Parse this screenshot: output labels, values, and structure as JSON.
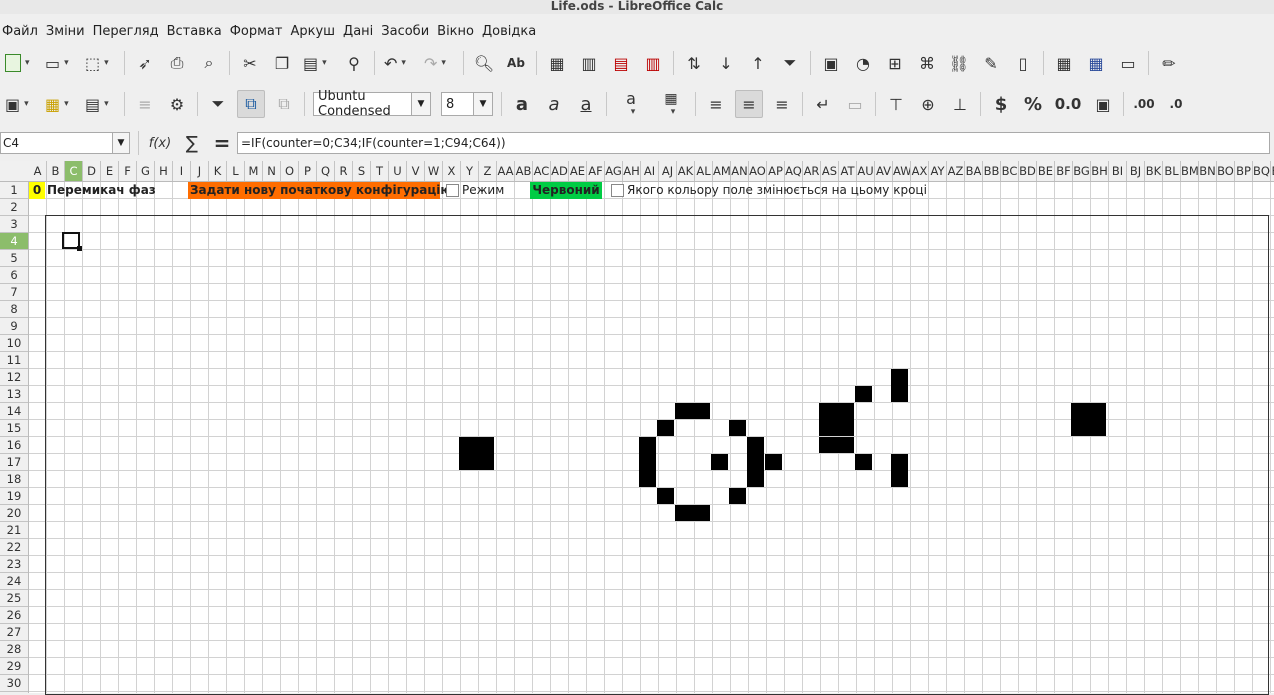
{
  "window": {
    "title": "Life.ods - LibreOffice Calc"
  },
  "menu": [
    "Файл",
    "Зміни",
    "Перегляд",
    "Вставка",
    "Формат",
    "Аркуш",
    "Дані",
    "Засоби",
    "Вікно",
    "Довідка"
  ],
  "toolbar": {
    "font_name": "Ubuntu Condensed",
    "font_size": "8",
    "bold_label": "a",
    "italic_label": "a",
    "underline_label": "a",
    "currency_label": "$",
    "percent_label": "%",
    "number_label": "0.0",
    "font_color": "#8b0000",
    "highlight_color": "#ffee00"
  },
  "formula_bar": {
    "name_box": "C4",
    "fx_label": "f(x)",
    "sum_label": "∑",
    "equals_label": "=",
    "formula": "=IF(counter=0;C34;IF(counter=1;C94;C64))"
  },
  "columns": [
    "A",
    "B",
    "C",
    "D",
    "E",
    "F",
    "G",
    "H",
    "I",
    "J",
    "K",
    "L",
    "M",
    "N",
    "O",
    "P",
    "Q",
    "R",
    "S",
    "T",
    "U",
    "V",
    "W",
    "X",
    "Y",
    "Z",
    "AA",
    "AB",
    "AC",
    "AD",
    "AE",
    "AF",
    "AG",
    "AH",
    "AI",
    "AJ",
    "AK",
    "AL",
    "AM",
    "AN",
    "AO",
    "AP",
    "AQ",
    "AR",
    "AS",
    "AT",
    "AU",
    "AV",
    "AW",
    "AX",
    "AY",
    "AZ",
    "BA",
    "BB",
    "BC",
    "BD",
    "BE",
    "BF",
    "BG",
    "BH",
    "BI",
    "BJ",
    "BK",
    "BL",
    "BM",
    "BN",
    "BO",
    "BP",
    "BQ",
    "BR"
  ],
  "selected_column": "C",
  "rows": [
    "1",
    "2",
    "3",
    "4",
    "5",
    "6",
    "7",
    "8",
    "9",
    "10",
    "11",
    "12",
    "13",
    "14",
    "15",
    "16",
    "17",
    "18",
    "19",
    "20",
    "21",
    "22",
    "23",
    "24",
    "25",
    "26",
    "27",
    "28",
    "29",
    "30"
  ],
  "selected_row": "4",
  "row1": {
    "counter_value": "0",
    "counter_color": "#ffff00",
    "phase_label": "Перемикач фаз",
    "new_config_label": "Задати нову початкову конфігурацію",
    "new_config_color": "#ff6d00",
    "mode_label": "Режим",
    "color_label": "Червоний",
    "color_label_bg": "#00cc44",
    "which_color_label": "Якого кольору поле змінюється на цьому кроці"
  }
}
